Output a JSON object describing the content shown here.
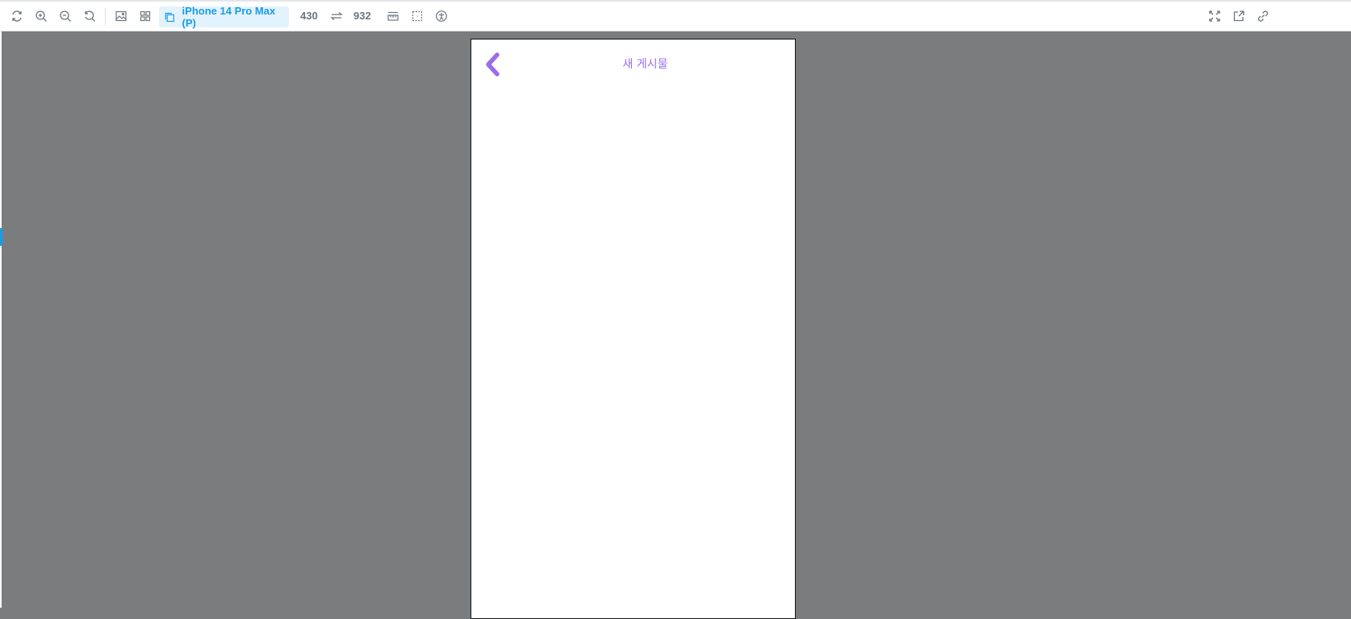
{
  "toolbar": {
    "left_icons": [
      "refresh-icon",
      "zoom-in-icon",
      "zoom-out-icon",
      "reset-zoom-icon",
      "image-icon",
      "grid-icon"
    ],
    "device": {
      "icon": "device-frame-icon",
      "label": "iPhone 14 Pro Max (P)"
    },
    "width_value": "430",
    "swap_icon": "swap-orientation-icon",
    "height_value": "932",
    "after_icons": [
      "ruler-icon",
      "outline-icon",
      "accessibility-icon"
    ],
    "right_icons": [
      "fullscreen-icon",
      "open-new-tab-icon",
      "copy-link-icon"
    ],
    "accent_color": "#1a9be6"
  },
  "app": {
    "header": {
      "back_icon": "chevron-left-icon",
      "title": "새 게시물"
    },
    "accent_color": "#9a6ee8",
    "background": "#ffffff"
  },
  "canvas": {
    "background": "#7b7c7e"
  }
}
